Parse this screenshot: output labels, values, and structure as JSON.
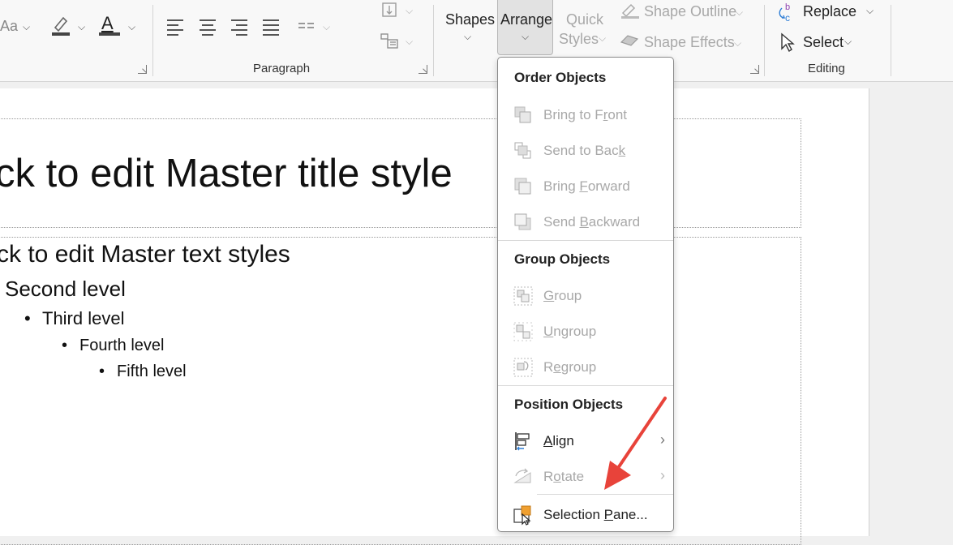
{
  "ribbon": {
    "font_group": {
      "aa_label": "Aa",
      "font_color_letter": "A"
    },
    "paragraph": {
      "label": "Paragraph"
    },
    "drawing": {
      "shapes_label": "Shapes",
      "arrange_label": "Arrange",
      "quick_styles_line1": "Quick",
      "quick_styles_line2": "Styles",
      "shape_outline_label": "Shape Outline",
      "shape_effects_label": "Shape Effects"
    },
    "editing": {
      "label": "Editing",
      "replace_label": "Replace",
      "select_label": "Select"
    }
  },
  "slide": {
    "title": "ck to edit Master title style",
    "body": {
      "level1": "ck to edit Master text styles",
      "level2": "Second level",
      "level3": "Third level",
      "level4": "Fourth level",
      "level5": "Fifth level"
    }
  },
  "arrange_menu": {
    "order_header": "Order Objects",
    "bring_to_front": {
      "pre": "Bring to F",
      "u": "r",
      "post": "ont"
    },
    "send_to_back": {
      "pre": "Send to Bac",
      "u": "k",
      "post": ""
    },
    "bring_forward": {
      "pre": "Bring ",
      "u": "F",
      "post": "orward"
    },
    "send_backward": {
      "pre": "Send ",
      "u": "B",
      "post": "ackward"
    },
    "group_header": "Group Objects",
    "group": {
      "pre": "",
      "u": "G",
      "post": "roup"
    },
    "ungroup": {
      "pre": "",
      "u": "U",
      "post": "ngroup"
    },
    "regroup": {
      "pre": "R",
      "u": "e",
      "post": "group"
    },
    "position_header": "Position Objects",
    "align": {
      "pre": "",
      "u": "A",
      "post": "lign"
    },
    "rotate": {
      "pre": "R",
      "u": "o",
      "post": "tate"
    },
    "selection_pane": {
      "pre": "Selection ",
      "u": "P",
      "post": "ane..."
    }
  },
  "colors": {
    "accent_arrow": "#e8433a",
    "disabled_text": "#a8a8a8",
    "align_icon_blue": "#2f7fd6",
    "selection_icon_orange": "#f0a030"
  }
}
